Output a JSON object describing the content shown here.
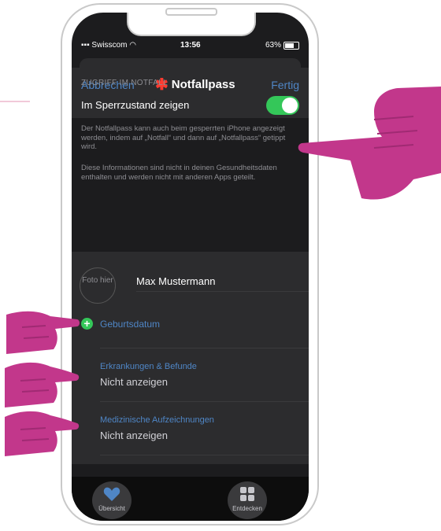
{
  "status": {
    "carrier": "Swisscom",
    "time": "13:56",
    "battery": "63%"
  },
  "nav": {
    "cancel": "Abbrechen",
    "title": "Notfallpass",
    "done": "Fertig"
  },
  "access": {
    "section_header": "ZUGRIFF IM NOTFALL",
    "toggle_label": "Im Sperrzustand zeigen",
    "toggle_on": true,
    "toggle_color": "#34c759",
    "footer1": "Der Notfallpass kann auch beim gesperrten iPhone angezeigt werden, indem auf „Notfall“ und dann auf „Notfallpass“ getippt wird.",
    "footer2": "Diese Informationen sind nicht in deinen Gesundheitsdaten enthalten und werden nicht mit anderen Apps geteilt."
  },
  "profile": {
    "photo_placeholder": "Foto hier",
    "name": "Max Mustermann",
    "birthdate_label": "Geburtsdatum",
    "rows": [
      {
        "title": "Erkrankungen & Befunde",
        "value": "Nicht anzeigen"
      },
      {
        "title": "Medizinische Aufzeichnungen",
        "value": "Nicht anzeigen"
      }
    ]
  },
  "tabs": [
    {
      "label": "Übersicht",
      "icon": "heart-icon"
    },
    {
      "label": "Entdecken",
      "icon": "grid-icon"
    }
  ],
  "colors": {
    "accent": "#4f86c6",
    "hand": "#c2378b",
    "star": "#ff3b30"
  }
}
